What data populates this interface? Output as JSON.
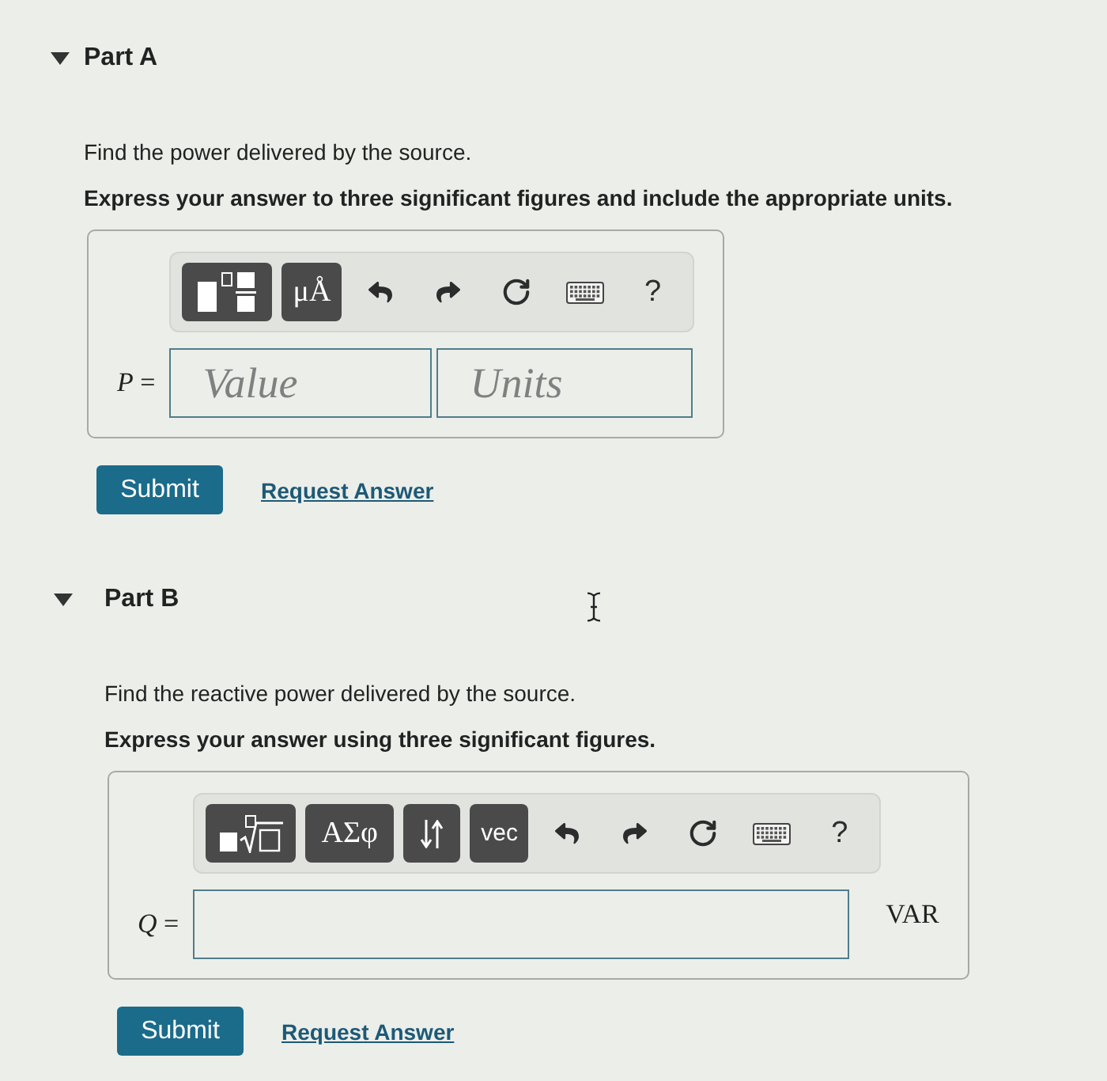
{
  "parts": [
    {
      "title": "Part A",
      "expanded": true,
      "prompt": "Find the power delivered by the source.",
      "instruction": "Express your answer to three significant figures and include the appropriate units.",
      "toolbar": [
        {
          "kind": "templates"
        },
        {
          "kind": "units",
          "label": "μÅ"
        },
        {
          "kind": "undo"
        },
        {
          "kind": "redo"
        },
        {
          "kind": "reset"
        },
        {
          "kind": "keyboard"
        },
        {
          "kind": "help",
          "label": "?"
        }
      ],
      "answer": {
        "label": "*P* =",
        "fields": [
          {
            "kind": "value",
            "placeholder": "Value"
          },
          {
            "kind": "units",
            "placeholder": "Units"
          }
        ]
      },
      "submit": "Submit",
      "request_answer": "Request Answer"
    },
    {
      "title": "Part B",
      "expanded": true,
      "prompt": "Find the reactive power delivered by the source.",
      "instruction": "Express your answer using three significant figures.",
      "toolbar": [
        {
          "kind": "templates-root"
        },
        {
          "kind": "symbols",
          "label": "ΑΣφ"
        },
        {
          "kind": "arrows"
        },
        {
          "kind": "vector",
          "label": "vec"
        },
        {
          "kind": "undo"
        },
        {
          "kind": "redo"
        },
        {
          "kind": "reset"
        },
        {
          "kind": "keyboard"
        },
        {
          "kind": "help",
          "label": "?"
        }
      ],
      "answer": {
        "label": "*Q* =",
        "fields": [
          {
            "kind": "number"
          }
        ],
        "unit": "VAR"
      },
      "submit": "Submit",
      "request_answer": "Request Answer"
    }
  ]
}
